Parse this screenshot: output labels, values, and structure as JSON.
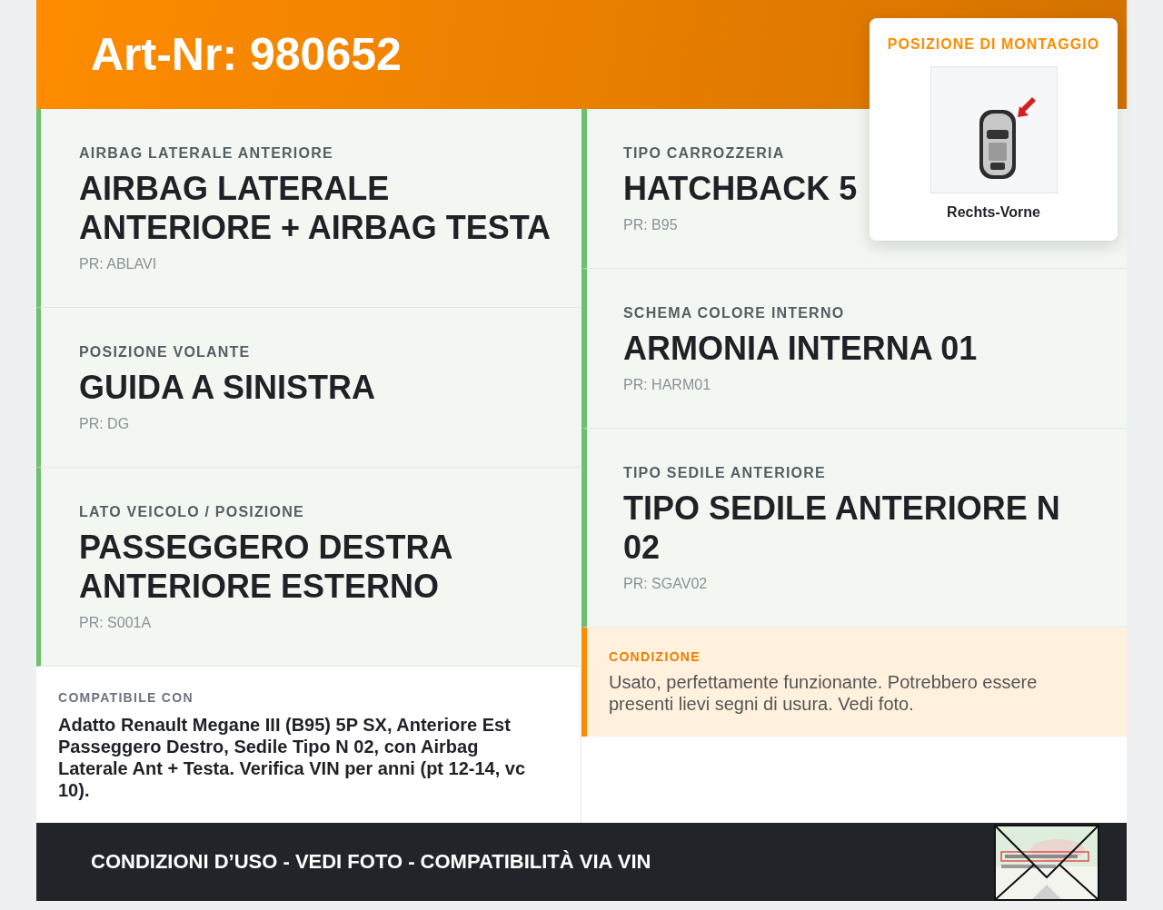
{
  "header": {
    "title": "Art-Nr: 980652"
  },
  "mounting": {
    "heading": "POSIZIONE DI MONTAGGIO",
    "caption": "Rechts-Vorne"
  },
  "left_specs": [
    {
      "label": "AIRBAG LATERALE ANTERIORE",
      "value": "AIRBAG LATERALE ANTERIORE + AIRBAG TESTA",
      "code": "PR: ABLAVI"
    },
    {
      "label": "POSIZIONE VOLANTE",
      "value": "GUIDA A SINISTRA",
      "code": "PR: DG"
    },
    {
      "label": "LATO VEICOLO / POSIZIONE",
      "value": "PASSEGGERO DESTRA ANTERIORE ESTERNO",
      "code": "PR: S001A"
    }
  ],
  "right_specs": [
    {
      "label": "TIPO CARROZZERIA",
      "value": "HATCHBACK 5",
      "code": "PR: B95"
    },
    {
      "label": "SCHEMA COLORE INTERNO",
      "value": "ARMONIA INTERNA 01",
      "code": "PR: HARM01"
    },
    {
      "label": "TIPO SEDILE ANTERIORE",
      "value": "TIPO SEDILE ANTERIORE N 02",
      "code": "PR: SGAV02"
    }
  ],
  "compatibility": {
    "label": "COMPATIBILE CON",
    "text": "Adatto Renault Megane III (B95) 5P SX, Anteriore Est Passeggero Destro, Sedile Tipo N 02, con Airbag Laterale Ant + Testa. Verifica VIN per anni (pt 12-14, vc 10)."
  },
  "condition": {
    "label": "CONDIZIONE",
    "text": "Usato, perfettamente funzionante. Potrebbero essere presenti lievi segni di usura. Vedi foto."
  },
  "footer": {
    "text": "CONDIZIONI D’USO - VEDI FOTO - COMPATIBILITÀ VIA VIN"
  }
}
